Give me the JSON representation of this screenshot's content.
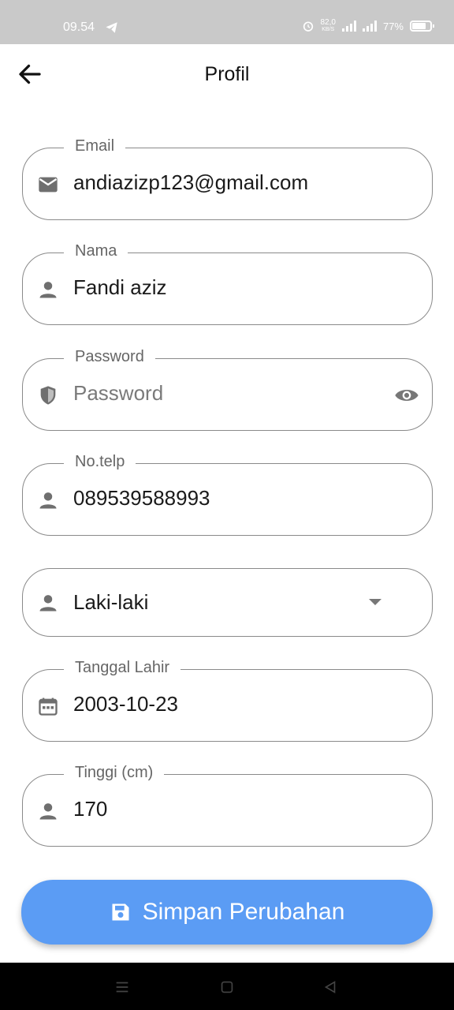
{
  "status_bar": {
    "time": "09.54",
    "speed_value": "82,0",
    "speed_unit": "KB/S",
    "battery": "77%"
  },
  "app_bar": {
    "title": "Profil"
  },
  "form": {
    "email": {
      "label": "Email",
      "value": "andiazizp123@gmail.com",
      "icon": "mail-icon"
    },
    "nama": {
      "label": "Nama",
      "value": "Fandi aziz",
      "icon": "person-icon"
    },
    "password": {
      "label": "Password",
      "placeholder": "Password",
      "icon": "shield-icon"
    },
    "telp": {
      "label": "No.telp",
      "value": "089539588993",
      "icon": "person-icon"
    },
    "gender": {
      "value": "Laki-laki",
      "icon": "person-icon"
    },
    "birth_date": {
      "label": "Tanggal Lahir",
      "value": "2003-10-23",
      "icon": "calendar-icon"
    },
    "height": {
      "label": "Tinggi (cm)",
      "value": "170",
      "icon": "person-icon"
    }
  },
  "save_button": {
    "label": "Simpan Perubahan"
  },
  "colors": {
    "primary_button": "#5b9cf4",
    "status_bar": "#c9c9c9",
    "field_border": "#8a8a8a"
  }
}
